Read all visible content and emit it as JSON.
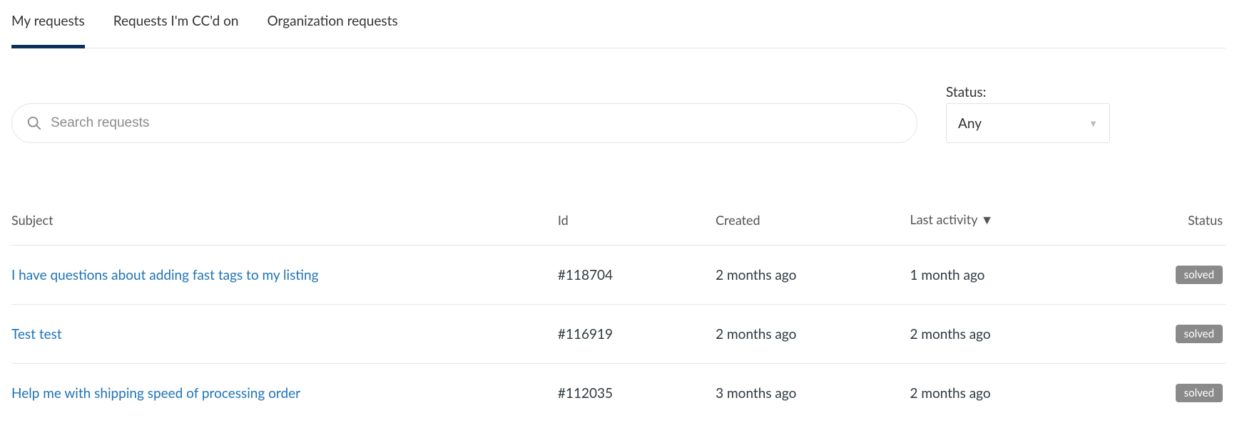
{
  "tabs": [
    {
      "label": "My requests",
      "active": true
    },
    {
      "label": "Requests I'm CC'd on",
      "active": false
    },
    {
      "label": "Organization requests",
      "active": false
    }
  ],
  "search": {
    "placeholder": "Search requests"
  },
  "status_filter": {
    "label": "Status:",
    "value": "Any"
  },
  "columns": {
    "subject": "Subject",
    "id": "Id",
    "created": "Created",
    "activity": "Last activity",
    "status": "Status",
    "sort_indicator": "▼"
  },
  "rows": [
    {
      "subject": "I have questions about adding fast tags to my listing",
      "id": "#118704",
      "created": "2 months ago",
      "activity": "1 month ago",
      "status": "solved"
    },
    {
      "subject": "Test test",
      "id": "#116919",
      "created": "2 months ago",
      "activity": "2 months ago",
      "status": "solved"
    },
    {
      "subject": "Help me with shipping speed of processing order",
      "id": "#112035",
      "created": "3 months ago",
      "activity": "2 months ago",
      "status": "solved"
    }
  ]
}
